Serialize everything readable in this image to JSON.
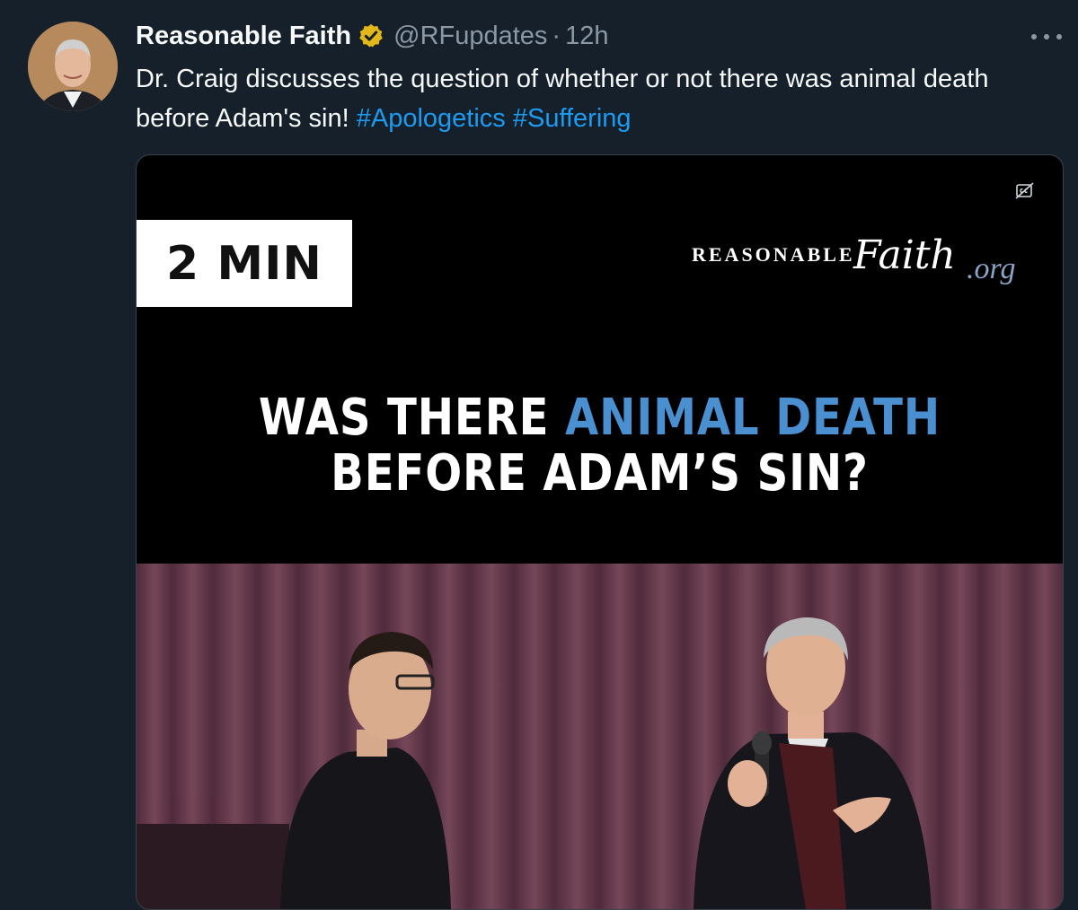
{
  "tweet": {
    "author_name": "Reasonable Faith",
    "handle": "@RFupdates",
    "separator": "·",
    "time": "12h",
    "text_main": "Dr. Craig discusses the question of whether or not there was animal death before Adam's sin!",
    "hashtag_1": "#Apologetics",
    "hashtag_2": "#Suffering"
  },
  "media": {
    "duration_label": "2 MIN",
    "logo_reasonable": "REASONABLE",
    "logo_faith": "Faith",
    "logo_org": ".org",
    "headline_line1_white": "WAS THERE",
    "headline_line1_blue": "ANIMAL DEATH",
    "headline_line2": "BEFORE ADAM’S SIN?"
  },
  "colors": {
    "background": "#15202b",
    "hashtag": "#1d9bf0",
    "headline_blue": "#4a8fcf",
    "secondary_text": "#8b98a5"
  },
  "icons": [
    "verified-badge-icon",
    "more-options-icon",
    "closed-captions-icon"
  ]
}
